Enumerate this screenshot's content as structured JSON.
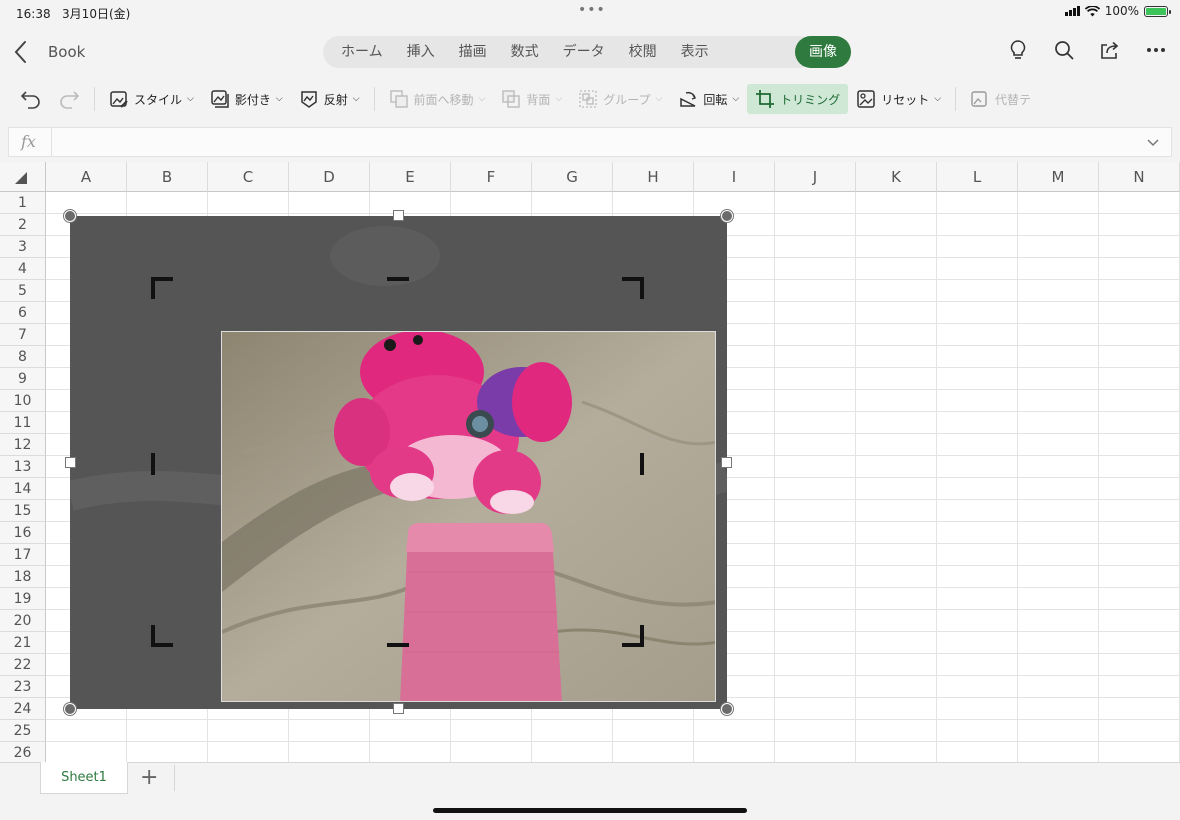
{
  "status": {
    "time": "16:38",
    "date": "3月10日(金)",
    "dots": "•••",
    "battery": "100%",
    "battery_level": 1.0
  },
  "titlebar": {
    "doc_title": "Book",
    "tabs": [
      "ホーム",
      "挿入",
      "描画",
      "数式",
      "データ",
      "校閲",
      "表示"
    ],
    "active_tab": "画像"
  },
  "ribbon": {
    "style": "スタイル",
    "shadow": "影付き",
    "reflection": "反射",
    "bring_forward": "前面へ移動",
    "send_back": "背面",
    "group": "グループ",
    "rotate": "回転",
    "crop": "トリミング",
    "reset": "リセット",
    "alt_text": "代替テ"
  },
  "formula_bar": {
    "fx": "fx",
    "value": ""
  },
  "grid": {
    "columns": [
      "A",
      "B",
      "C",
      "D",
      "E",
      "F",
      "G",
      "H",
      "I",
      "J",
      "K",
      "L",
      "M",
      "N"
    ],
    "rows": [
      "1",
      "2",
      "3",
      "4",
      "5",
      "6",
      "7",
      "8",
      "9",
      "10",
      "11",
      "12",
      "13",
      "14",
      "15",
      "16",
      "17",
      "18",
      "19",
      "20",
      "21",
      "22",
      "23",
      "24",
      "25",
      "26"
    ]
  },
  "sheets": {
    "tabs": [
      "Sheet1"
    ],
    "add": "+"
  },
  "colors": {
    "accent": "#2e7a3f",
    "crop_active_bg": "#cfe8d5"
  }
}
